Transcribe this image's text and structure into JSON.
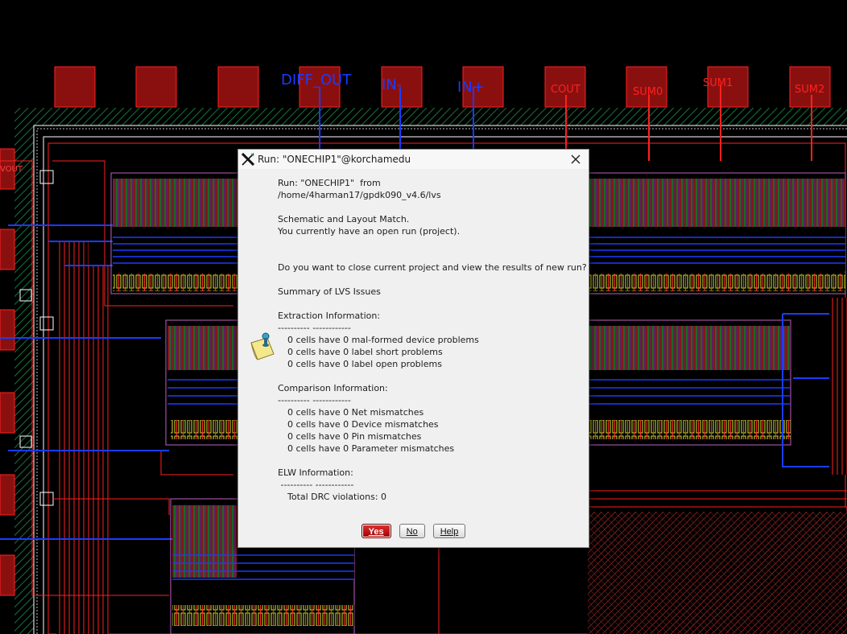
{
  "canvas": {
    "pin_labels": {
      "diff_out": "DIFF_OUT",
      "in_minus": "IN-",
      "in_plus": "IN+",
      "cout": "COUT",
      "sum0": "SUM0",
      "sum1": "SUM1",
      "sum2": "SUM2",
      "vout": "VOUT"
    },
    "colors": {
      "background": "#000000",
      "metal1": "#1a3cff",
      "metal2": "#ff2020",
      "via": "#ffff00",
      "diff": "#00c000",
      "nwell": "#00aa55"
    }
  },
  "dialog": {
    "title": "Run: \"ONECHIP1\"@korchamedu",
    "run_line": "Run: \"ONECHIP1\"  from",
    "path": "/home/4harman17/gpdk090_v4.6/lvs",
    "match": "Schematic and Layout Match.",
    "open_run": "You currently have an open run (project).",
    "question": "Do you want to close current project and view the results of new run?",
    "summary": "Summary of LVS Issues",
    "extraction_header": "Extraction Information:",
    "separator": "---------- ------------",
    "extraction_items": [
      "0 cells have 0 mal-formed device problems",
      "0 cells have 0 label short problems",
      "0 cells have 0 label open problems"
    ],
    "comparison_header": "Comparison Information:",
    "comparison_items": [
      "0 cells have 0 Net mismatches",
      "0 cells have 0 Device mismatches",
      "0 cells have 0 Pin mismatches",
      "0 cells have 0 Parameter mismatches"
    ],
    "elw_header": "ELW Information:",
    "elw_separator": " ---------- ------------",
    "drc": "Total DRC violations: 0",
    "buttons": {
      "yes": "Yes",
      "no": "No",
      "help": "Help"
    },
    "icons": {
      "app": "x-window-icon",
      "close": "close-icon",
      "info": "note-icon"
    }
  }
}
